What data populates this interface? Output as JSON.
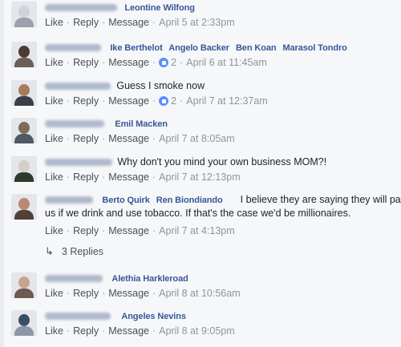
{
  "actions": {
    "like": "Like",
    "reply": "Reply",
    "message": "Message",
    "sep": "·"
  },
  "comments": [
    {
      "tags": [
        "Leontine Wilfong"
      ],
      "text": "",
      "time": "April 5 at 2:33pm",
      "likes": "",
      "avatar_colors": [
        "#cfd3da",
        "#9aa1ab"
      ]
    },
    {
      "tags": [
        "Ike Berthelot",
        "Angelo Backer",
        "Ben Koan",
        "Marasol Tondro"
      ],
      "text": "",
      "time": "April 6 at 11:45am",
      "likes": "2",
      "avatar_colors": [
        "#4b3b33",
        "#6b6058"
      ]
    },
    {
      "tags": [],
      "text": "Guess I smoke now",
      "time": "April 7 at 12:37am",
      "likes": "2",
      "avatar_colors": [
        "#a67b5b",
        "#3c3f48"
      ]
    },
    {
      "tags": [
        "Emil Macken"
      ],
      "text": "",
      "time": "April 7 at 8:05am",
      "likes": "",
      "avatar_colors": [
        "#7e6b5a",
        "#4f5a66"
      ]
    },
    {
      "tags": [],
      "text": "Why don't you mind your own business MOM?!",
      "time": "April 7 at 12:13pm",
      "likes": "",
      "avatar_colors": [
        "#d6cfc6",
        "#2f3a2c"
      ]
    },
    {
      "tags": [
        "Berto Quirk",
        "Ren Biondiando"
      ],
      "text": "I believe they are saying they will pay",
      "text2": "us if we drink and use tobacco. If that's the case we'd be millionaires.",
      "time": "April 7 at 4:13pm",
      "likes": "",
      "avatar_colors": [
        "#b98a6e",
        "#51403a"
      ]
    },
    {
      "tags": [
        "Alethia Harkleroad"
      ],
      "text": "",
      "time": "April 8 at 10:56am",
      "likes": "",
      "avatar_colors": [
        "#c9a489",
        "#6f5a50"
      ]
    },
    {
      "tags": [
        "Angeles Nevins"
      ],
      "text": "",
      "time": "April 8 at 9:05pm",
      "likes": "",
      "avatar_colors": [
        "#3c4e63",
        "#8c96a6"
      ]
    }
  ],
  "replies_label": "3 Replies"
}
